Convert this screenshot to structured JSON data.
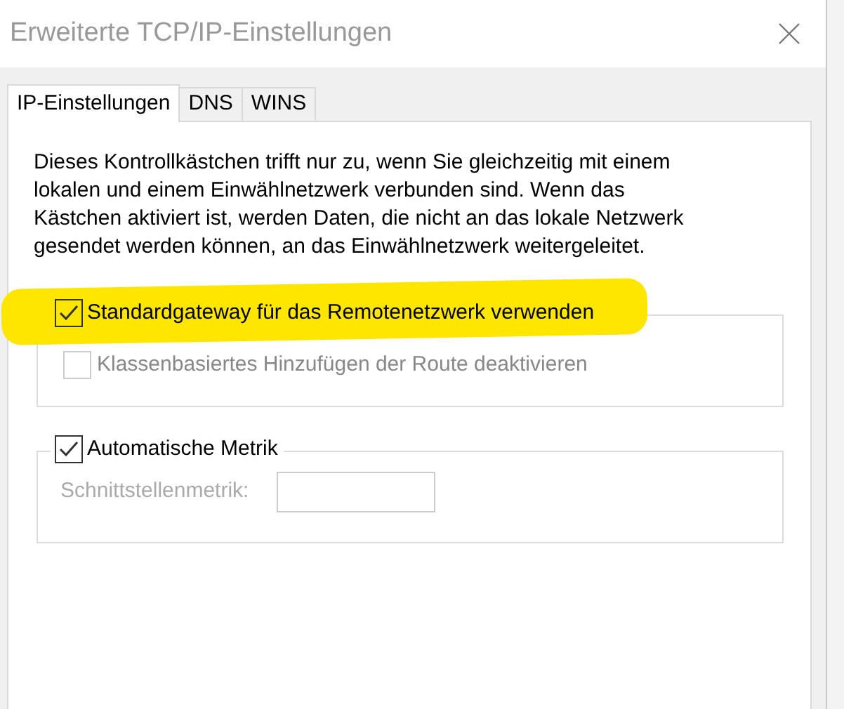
{
  "window": {
    "title": "Erweiterte TCP/IP-Einstellungen"
  },
  "tabs": [
    {
      "label": "IP-Einstellungen",
      "selected": true
    },
    {
      "label": "DNS",
      "selected": false
    },
    {
      "label": "WINS",
      "selected": false
    }
  ],
  "description": "Dieses Kontrollkästchen trifft nur zu, wenn Sie gleichzeitig mit einem lokalen und einem Einwählnetzwerk verbunden sind. Wenn das Kästchen aktiviert ist, werden Daten, die nicht an das lokale Netzwerk gesendet werden können, an das Einwählnetzwerk weitergeleitet.",
  "groups": [
    {
      "header": {
        "label": "Standardgateway für das Remotenetzwerk verwenden",
        "checked": true,
        "highlighted": true
      },
      "items": [
        {
          "kind": "checkbox",
          "label": "Klassenbasiertes Hinzufügen der Route deaktivieren",
          "checked": false,
          "disabled": true
        }
      ]
    },
    {
      "header": {
        "label": "Automatische Metrik",
        "checked": true,
        "highlighted": false
      },
      "items": [
        {
          "kind": "field",
          "label": "Schnittstellenmetrik:",
          "disabled": true
        }
      ]
    }
  ]
}
